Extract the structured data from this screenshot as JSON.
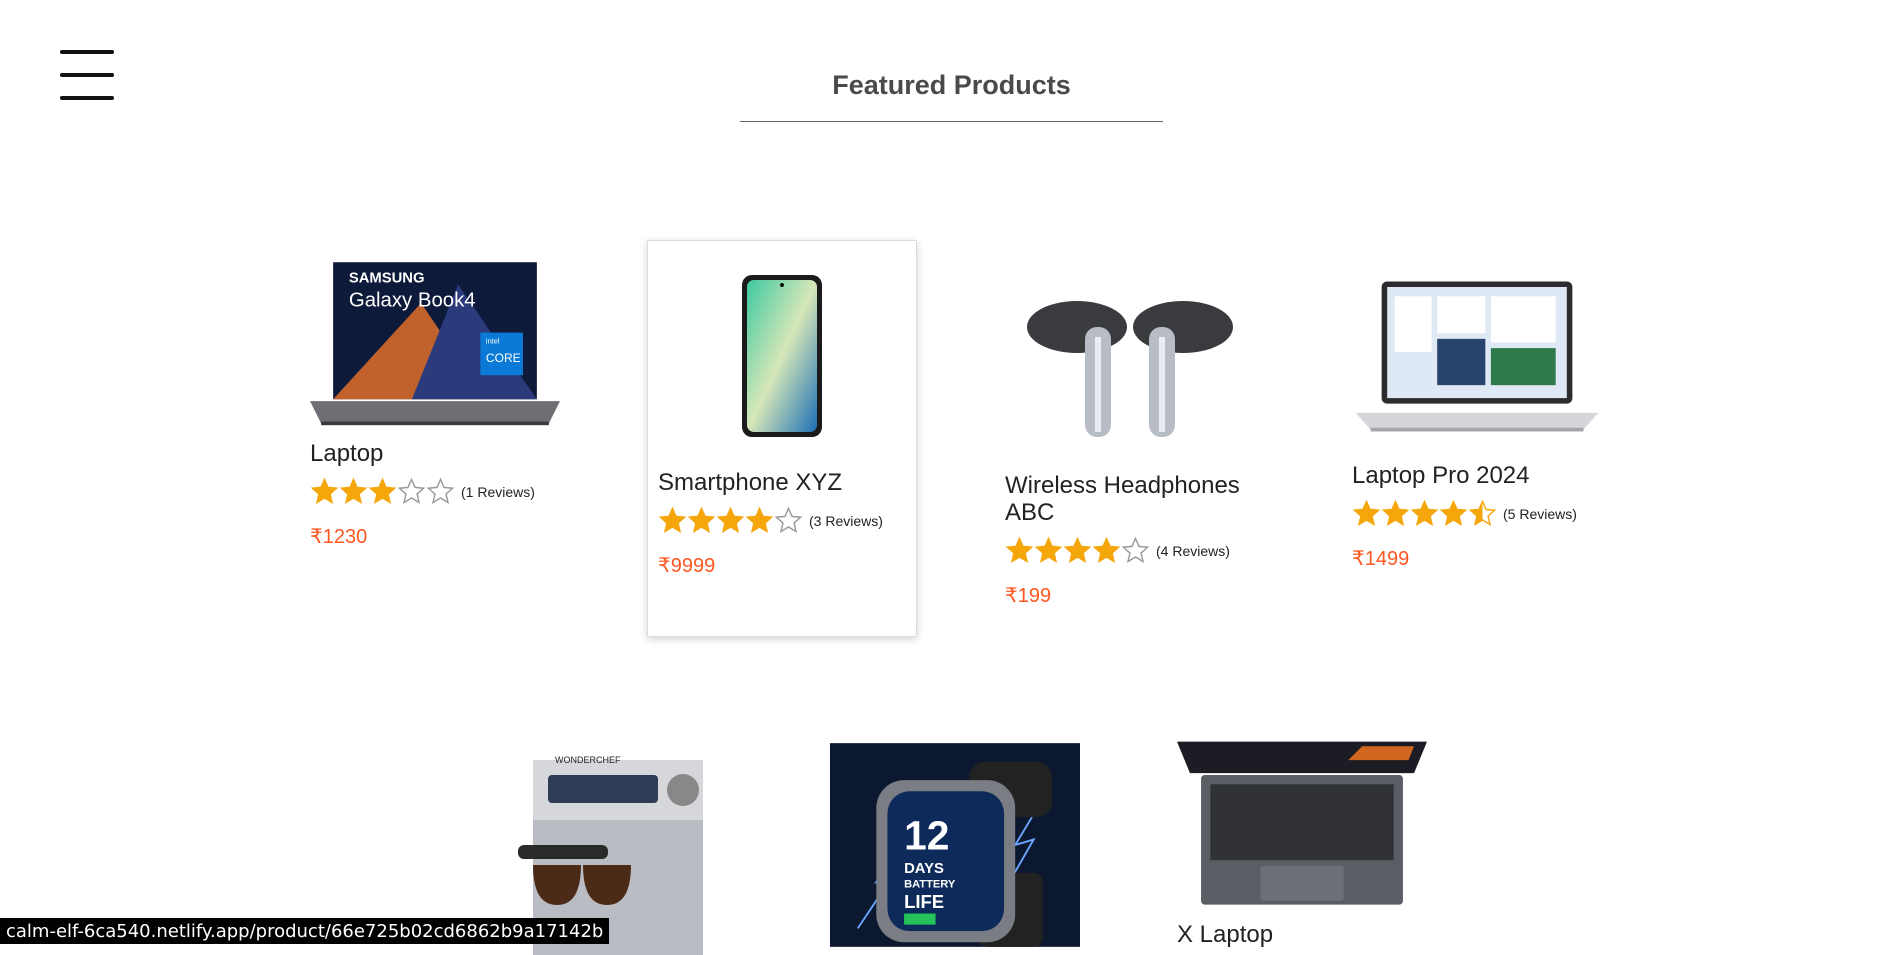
{
  "header": {
    "title": "Featured Products"
  },
  "colors": {
    "accent_price": "#ff5722",
    "star": "#f5a60a",
    "star_empty": "#9a9a9a"
  },
  "products": [
    {
      "name": "Laptop",
      "rating": 3,
      "reviews": "(1 Reviews)",
      "price": "₹1230"
    },
    {
      "name": "Smartphone XYZ",
      "rating": 4,
      "reviews": "(3 Reviews)",
      "price": "₹9999"
    },
    {
      "name": "Wireless Headphones ABC",
      "rating": 4,
      "reviews": "(4 Reviews)",
      "price": "₹199"
    },
    {
      "name": "Laptop Pro 2024",
      "rating": 4.5,
      "reviews": "(5 Reviews)",
      "price": "₹1499"
    },
    {
      "name": "",
      "rating": 0,
      "reviews": "",
      "price": ""
    },
    {
      "name": "",
      "rating": 0,
      "reviews": "",
      "price": ""
    },
    {
      "name": "X Laptop",
      "rating": 0,
      "reviews": "",
      "price": ""
    }
  ],
  "product_images": {
    "p0": {
      "brand": "SAMSUNG",
      "model": "Galaxy Book4",
      "badge_top": "intel",
      "badge_main": "CORE"
    },
    "p4": {
      "brand": "WONDERCHEF"
    },
    "p5": {
      "big": "12",
      "line1": "DAYS",
      "line2": "BATTERY",
      "line3": "LIFE"
    }
  },
  "status_bar": {
    "url": "calm-elf-6ca540.netlify.app/product/66e725b02cd6862b9a17142b"
  }
}
